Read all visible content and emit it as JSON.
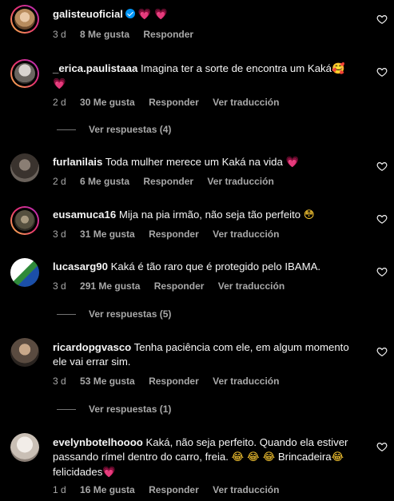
{
  "comments": [
    {
      "username": "galisteuoficial",
      "verified": true,
      "text": "",
      "emoji": "💗 💗",
      "time": "3 d",
      "likes": "8 Me gusta",
      "reply": "Responder",
      "translate": ""
    },
    {
      "username": "_erica.paulistaaa",
      "text": "Imagina ter a sorte de encontra um Kaká",
      "emoji": "🥰",
      "emoji2": "💗",
      "time": "2 d",
      "likes": "30 Me gusta",
      "reply": "Responder",
      "translate": "Ver traducción",
      "replies": "Ver respuestas (4)"
    },
    {
      "username": "furlanilais",
      "text": "Toda mulher merece um Kaká na vida",
      "emoji": "💗",
      "time": "2 d",
      "likes": "6 Me gusta",
      "reply": "Responder",
      "translate": "Ver traducción"
    },
    {
      "username": "eusamuca16",
      "text": "Mija na pia irmão, não seja tão perfeito",
      "emoji": "😳",
      "time": "3 d",
      "likes": "31 Me gusta",
      "reply": "Responder",
      "translate": "Ver traducción"
    },
    {
      "username": "lucasarg90",
      "text": "Kaká é tão raro que é protegido pelo IBAMA.",
      "time": "3 d",
      "likes": "291 Me gusta",
      "reply": "Responder",
      "translate": "Ver traducción",
      "replies": "Ver respuestas (5)"
    },
    {
      "username": "ricardopgvasco",
      "text": "Tenha paciência com ele, em algum momento ele vai errar sim.",
      "time": "3 d",
      "likes": "53 Me gusta",
      "reply": "Responder",
      "translate": "Ver traducción",
      "replies": "Ver respuestas (1)"
    },
    {
      "username": "evelynbotelhoooo",
      "text": "Kaká, não seja perfeito. Quando ela estiver passando rímel dentro do carro, freia.",
      "emoji": "😂 😂 😂",
      "text2": "Brincadeira",
      "emoji2": "😂",
      "text3": "felicidades",
      "emoji3": "💗",
      "time": "1 d",
      "likes": "16 Me gusta",
      "reply": "Responder",
      "translate": "Ver traducción"
    }
  ],
  "icons": {
    "like": "heart-outline-icon",
    "verified": "verified-badge-icon"
  },
  "colors": {
    "background": "#000000",
    "text": "#f5f5f5",
    "secondary": "#a8a8a8",
    "verified": "#0095f6",
    "story_ring": "#e8336e"
  }
}
